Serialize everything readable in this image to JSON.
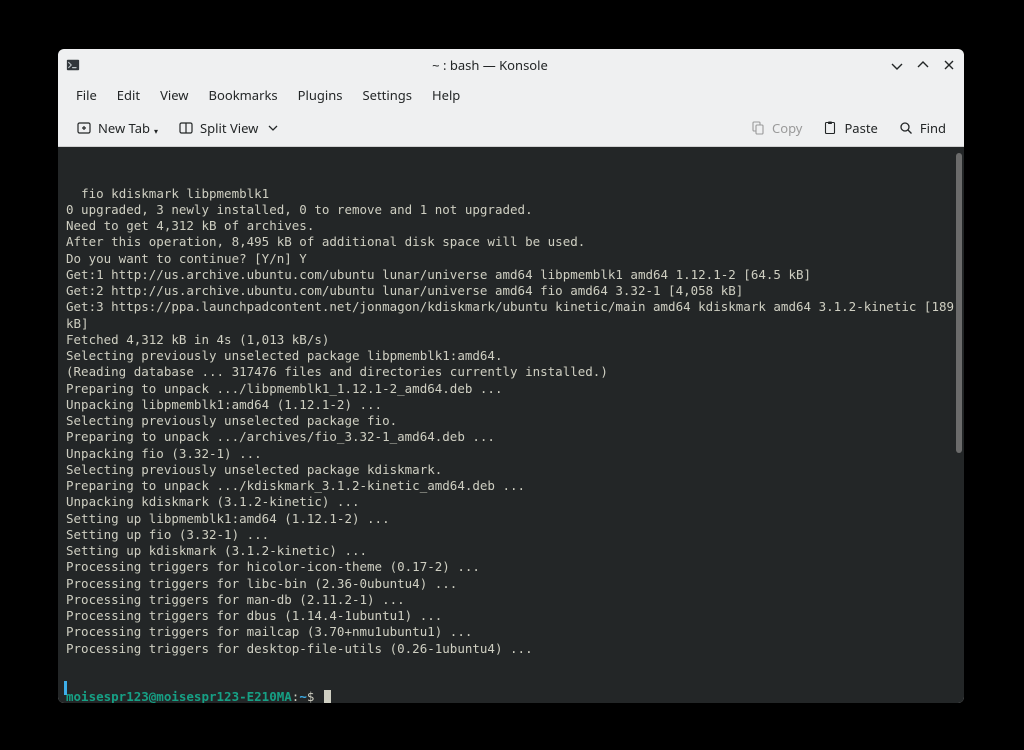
{
  "title": "~ : bash — Konsole",
  "menu": [
    "File",
    "Edit",
    "View",
    "Bookmarks",
    "Plugins",
    "Settings",
    "Help"
  ],
  "toolbar": {
    "new_tab": "New Tab",
    "split_view": "Split View",
    "copy": "Copy",
    "paste": "Paste",
    "find": "Find"
  },
  "terminal": {
    "lines": [
      "  fio kdiskmark libpmemblk1",
      "0 upgraded, 3 newly installed, 0 to remove and 1 not upgraded.",
      "Need to get 4,312 kB of archives.",
      "After this operation, 8,495 kB of additional disk space will be used.",
      "Do you want to continue? [Y/n] Y",
      "Get:1 http://us.archive.ubuntu.com/ubuntu lunar/universe amd64 libpmemblk1 amd64 1.12.1-2 [64.5 kB]",
      "Get:2 http://us.archive.ubuntu.com/ubuntu lunar/universe amd64 fio amd64 3.32-1 [4,058 kB]",
      "Get:3 https://ppa.launchpadcontent.net/jonmagon/kdiskmark/ubuntu kinetic/main amd64 kdiskmark amd64 3.1.2-kinetic [189 kB]",
      "Fetched 4,312 kB in 4s (1,013 kB/s)",
      "Selecting previously unselected package libpmemblk1:amd64.",
      "(Reading database ... 317476 files and directories currently installed.)",
      "Preparing to unpack .../libpmemblk1_1.12.1-2_amd64.deb ...",
      "Unpacking libpmemblk1:amd64 (1.12.1-2) ...",
      "Selecting previously unselected package fio.",
      "Preparing to unpack .../archives/fio_3.32-1_amd64.deb ...",
      "Unpacking fio (3.32-1) ...",
      "Selecting previously unselected package kdiskmark.",
      "Preparing to unpack .../kdiskmark_3.1.2-kinetic_amd64.deb ...",
      "Unpacking kdiskmark (3.1.2-kinetic) ...",
      "Setting up libpmemblk1:amd64 (1.12.1-2) ...",
      "Setting up fio (3.32-1) ...",
      "Setting up kdiskmark (3.1.2-kinetic) ...",
      "Processing triggers for hicolor-icon-theme (0.17-2) ...",
      "Processing triggers for libc-bin (2.36-0ubuntu4) ...",
      "Processing triggers for man-db (2.11.2-1) ...",
      "Processing triggers for dbus (1.14.4-1ubuntu1) ...",
      "Processing triggers for mailcap (3.70+nmu1ubuntu1) ...",
      "Processing triggers for desktop-file-utils (0.26-1ubuntu4) ..."
    ],
    "prompt_user": "moisespr123@moisespr123-E210MA",
    "prompt_colon": ":",
    "prompt_path": "~",
    "prompt_dollar": "$"
  }
}
